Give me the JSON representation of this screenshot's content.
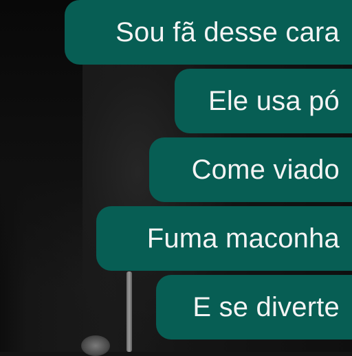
{
  "messages": [
    {
      "text": "Sou fã desse cara"
    },
    {
      "text": "Ele usa pó"
    },
    {
      "text": "Come viado"
    },
    {
      "text": "Fuma maconha"
    },
    {
      "text": "E se diverte"
    }
  ]
}
